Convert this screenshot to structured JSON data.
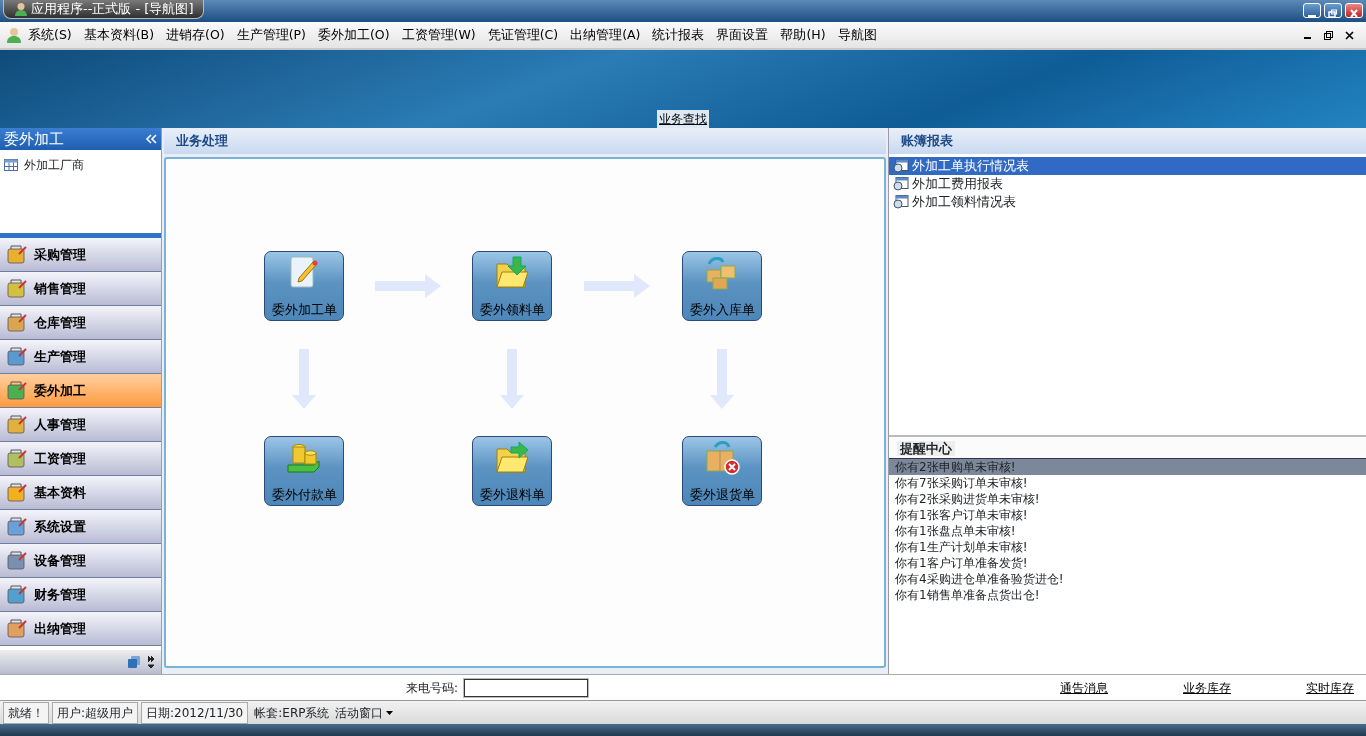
{
  "window": {
    "title": "应用程序--正式版 - [导航图]"
  },
  "menu": [
    {
      "label": "系统(S)"
    },
    {
      "label": "基本资料(B)"
    },
    {
      "label": "进销存(O)"
    },
    {
      "label": "生产管理(P)"
    },
    {
      "label": "委外加工(O)"
    },
    {
      "label": "工资管理(W)"
    },
    {
      "label": "凭证管理(C)"
    },
    {
      "label": "出纳管理(A)"
    },
    {
      "label": "统计报表"
    },
    {
      "label": "界面设置"
    },
    {
      "label": "帮助(H)"
    },
    {
      "label": "导航图"
    }
  ],
  "banner": {
    "link": "业务查找"
  },
  "sidebar": {
    "title": "委外加工",
    "tree": [
      {
        "label": "外加工厂商"
      }
    ],
    "modules": [
      {
        "label": "采购管理",
        "selected": false
      },
      {
        "label": "销售管理",
        "selected": false
      },
      {
        "label": "仓库管理",
        "selected": false
      },
      {
        "label": "生产管理",
        "selected": false
      },
      {
        "label": "委外加工",
        "selected": true
      },
      {
        "label": "人事管理",
        "selected": false
      },
      {
        "label": "工资管理",
        "selected": false
      },
      {
        "label": "基本资料",
        "selected": false
      },
      {
        "label": "系统设置",
        "selected": false
      },
      {
        "label": "设备管理",
        "selected": false
      },
      {
        "label": "财务管理",
        "selected": false
      },
      {
        "label": "出纳管理",
        "selected": false
      }
    ]
  },
  "workflow": {
    "title": "业务处理",
    "nodes": [
      {
        "label": "委外加工单",
        "kind": "edit"
      },
      {
        "label": "委外领料单",
        "kind": "folder_in"
      },
      {
        "label": "委外入库单",
        "kind": "boxes"
      },
      {
        "label": "委外付款单",
        "kind": "coins"
      },
      {
        "label": "委外退料单",
        "kind": "folder_out"
      },
      {
        "label": "委外退货单",
        "kind": "box_cancel"
      }
    ]
  },
  "reports": {
    "title": "账簿报表",
    "items": [
      {
        "label": "外加工单执行情况表",
        "selected": true
      },
      {
        "label": "外加工费用报表",
        "selected": false
      },
      {
        "label": "外加工领料情况表",
        "selected": false
      }
    ]
  },
  "reminders": {
    "title": "提醒中心",
    "items": [
      {
        "text": "你有2张申购单未审核!",
        "selected": true
      },
      {
        "text": "你有7张采购订单未审核!",
        "selected": false
      },
      {
        "text": "你有2张采购进货单未审核!",
        "selected": false
      },
      {
        "text": "你有1张客户订单未审核!",
        "selected": false
      },
      {
        "text": "你有1张盘点单未审核!",
        "selected": false
      },
      {
        "text": "你有1生产计划单未审核!",
        "selected": false
      },
      {
        "text": "你有1客户订单准备发货!",
        "selected": false
      },
      {
        "text": "你有4采购进仓单准备验货进仓!",
        "selected": false
      },
      {
        "text": "你有1销售单准备点货出仓!",
        "selected": false
      }
    ]
  },
  "phone": {
    "label": "来电号码:"
  },
  "links": [
    "通告消息",
    "业务库存",
    "实时库存"
  ],
  "status_bar": [
    {
      "text": "就绪！",
      "kind": "panel"
    },
    {
      "text": "用户:超级用户",
      "kind": "panel"
    },
    {
      "text": "日期:2012/11/30",
      "kind": "panel"
    },
    {
      "text": "帐套:ERP系统",
      "kind": "plain"
    },
    {
      "text": "活动窗口",
      "kind": "dropdown"
    }
  ]
}
